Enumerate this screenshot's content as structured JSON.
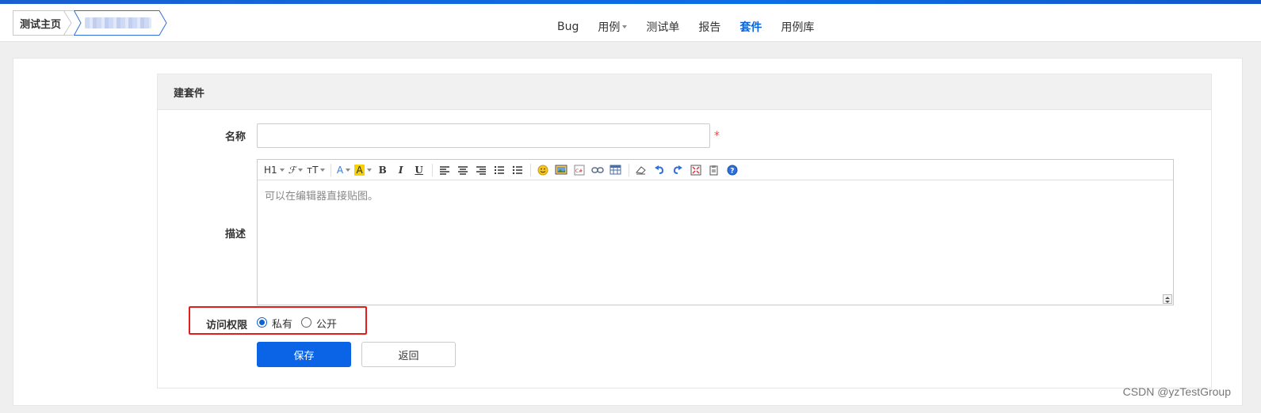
{
  "breadcrumb": {
    "home": "测试主页"
  },
  "nav": {
    "items": [
      {
        "label": "Bug"
      },
      {
        "label": "用例"
      },
      {
        "label": "测试单"
      },
      {
        "label": "报告"
      },
      {
        "label": "套件"
      },
      {
        "label": "用例库"
      }
    ],
    "active": "套件"
  },
  "form": {
    "title": "建套件",
    "name_label": "名称",
    "name_value": "",
    "required_mark": "*",
    "desc_label": "描述",
    "desc_placeholder": "可以在编辑器直接贴图。",
    "toolbar": {
      "heading": "H1",
      "font_family": "ℱ",
      "font_size": "тT",
      "font_color": "A",
      "bg_color": "A",
      "bold": "B",
      "italic": "I",
      "underline": "U"
    },
    "access_label": "访问权限",
    "access_options": [
      {
        "label": "私有",
        "checked": true
      },
      {
        "label": "公开",
        "checked": false
      }
    ],
    "save_label": "保存",
    "back_label": "返回"
  },
  "watermark": "CSDN @yzTestGroup",
  "colors": {
    "accent": "#0b63e6",
    "highlight_box": "#e21d1d"
  }
}
